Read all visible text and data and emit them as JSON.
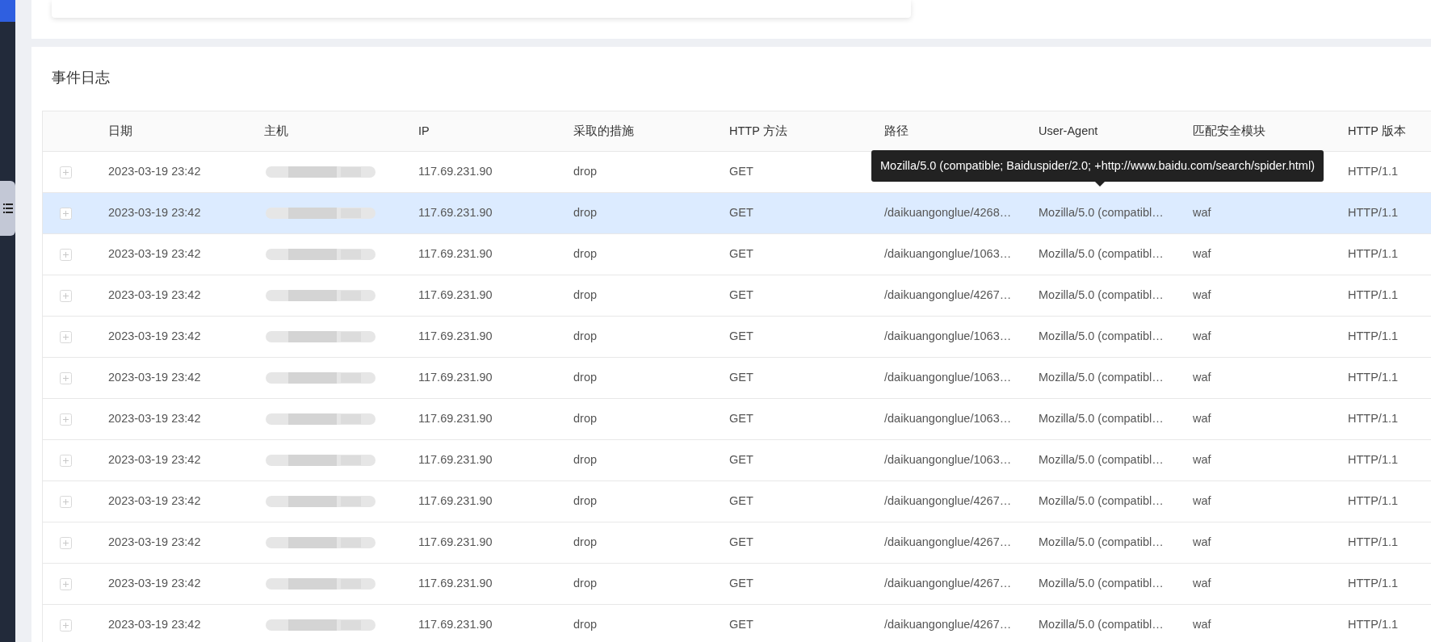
{
  "section_title": "事件日志",
  "columns": [
    "日期",
    "主机",
    "IP",
    "采取的措施",
    "HTTP 方法",
    "路径",
    "User-Agent",
    "匹配安全模块",
    "HTTP 版本"
  ],
  "rows": [
    {
      "date": "2023-03-19 23:42",
      "ip": "117.69.231.90",
      "action": "drop",
      "method": "GET",
      "version": "HTTP/1.1",
      "hovered": false
    },
    {
      "date": "2023-03-19 23:42",
      "ip": "117.69.231.90",
      "action": "drop",
      "method": "GET",
      "path": "/daikuangonglue/4268…",
      "user_agent": "Mozilla/5.0 (compatibl…",
      "module": "waf",
      "version": "HTTP/1.1",
      "hovered": true
    },
    {
      "date": "2023-03-19 23:42",
      "ip": "117.69.231.90",
      "action": "drop",
      "method": "GET",
      "path": "/daikuangonglue/1063…",
      "user_agent": "Mozilla/5.0 (compatibl…",
      "module": "waf",
      "version": "HTTP/1.1",
      "hovered": false
    },
    {
      "date": "2023-03-19 23:42",
      "ip": "117.69.231.90",
      "action": "drop",
      "method": "GET",
      "path": "/daikuangonglue/4267…",
      "user_agent": "Mozilla/5.0 (compatibl…",
      "module": "waf",
      "version": "HTTP/1.1",
      "hovered": false
    },
    {
      "date": "2023-03-19 23:42",
      "ip": "117.69.231.90",
      "action": "drop",
      "method": "GET",
      "path": "/daikuangonglue/1063…",
      "user_agent": "Mozilla/5.0 (compatibl…",
      "module": "waf",
      "version": "HTTP/1.1",
      "hovered": false
    },
    {
      "date": "2023-03-19 23:42",
      "ip": "117.69.231.90",
      "action": "drop",
      "method": "GET",
      "path": "/daikuangonglue/1063…",
      "user_agent": "Mozilla/5.0 (compatibl…",
      "module": "waf",
      "version": "HTTP/1.1",
      "hovered": false
    },
    {
      "date": "2023-03-19 23:42",
      "ip": "117.69.231.90",
      "action": "drop",
      "method": "GET",
      "path": "/daikuangonglue/1063…",
      "user_agent": "Mozilla/5.0 (compatibl…",
      "module": "waf",
      "version": "HTTP/1.1",
      "hovered": false
    },
    {
      "date": "2023-03-19 23:42",
      "ip": "117.69.231.90",
      "action": "drop",
      "method": "GET",
      "path": "/daikuangonglue/1063…",
      "user_agent": "Mozilla/5.0 (compatibl…",
      "module": "waf",
      "version": "HTTP/1.1",
      "hovered": false
    },
    {
      "date": "2023-03-19 23:42",
      "ip": "117.69.231.90",
      "action": "drop",
      "method": "GET",
      "path": "/daikuangonglue/4267…",
      "user_agent": "Mozilla/5.0 (compatibl…",
      "module": "waf",
      "version": "HTTP/1.1",
      "hovered": false
    },
    {
      "date": "2023-03-19 23:42",
      "ip": "117.69.231.90",
      "action": "drop",
      "method": "GET",
      "path": "/daikuangonglue/4267…",
      "user_agent": "Mozilla/5.0 (compatibl…",
      "module": "waf",
      "version": "HTTP/1.1",
      "hovered": false
    },
    {
      "date": "2023-03-19 23:42",
      "ip": "117.69.231.90",
      "action": "drop",
      "method": "GET",
      "path": "/daikuangonglue/4267…",
      "user_agent": "Mozilla/5.0 (compatibl…",
      "module": "waf",
      "version": "HTTP/1.1",
      "hovered": false
    },
    {
      "date": "2023-03-19 23:42",
      "ip": "117.69.231.90",
      "action": "drop",
      "method": "GET",
      "path": "/daikuangonglue/4267…",
      "user_agent": "Mozilla/5.0 (compatibl…",
      "module": "waf",
      "version": "HTTP/1.1",
      "hovered": false
    }
  ],
  "tooltip": {
    "text": "Mozilla/5.0 (compatible; Baiduspider/2.0; +http://www.baidu.com/search/spider.html)"
  }
}
